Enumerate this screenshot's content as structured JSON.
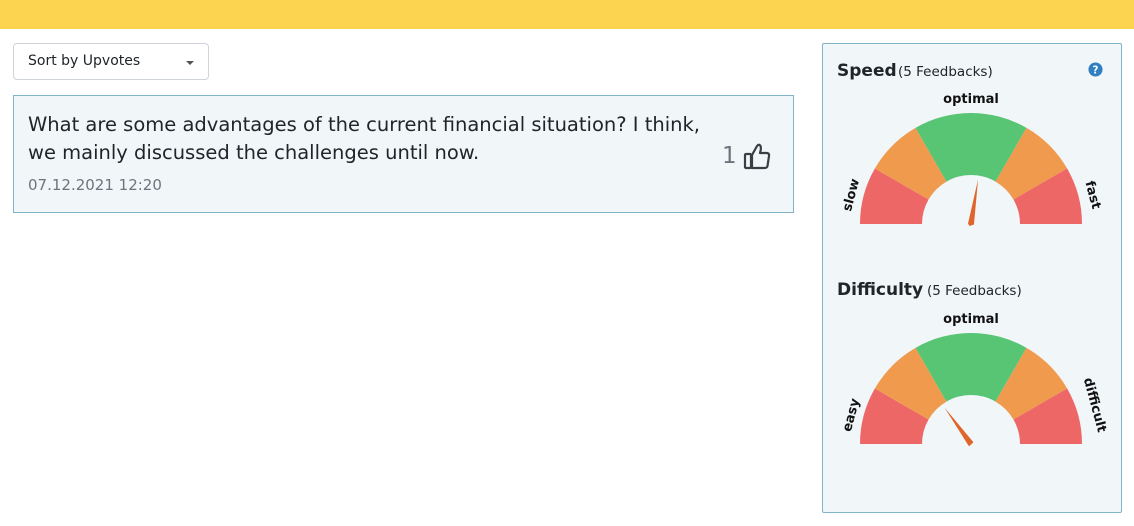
{
  "header": {
    "color": "#fdd44f"
  },
  "sort": {
    "selected": "Sort by Upvotes"
  },
  "question": {
    "text": "What are some advantages of the current financial situation? I think, we mainly discussed the challenges until now.",
    "timestamp": "07.12.2021 12:20",
    "upvotes": "1",
    "upvote_icon": "thumbs-up-icon"
  },
  "feedback": {
    "help_icon": "question-circle-icon",
    "speed": {
      "title": "Speed",
      "count": "(5 Feedbacks)",
      "label_top": "optimal",
      "label_left": "slow",
      "label_right": "fast",
      "needle_level": 0.55
    },
    "difficulty": {
      "title": "Difficulty",
      "count": "(5 Feedbacks)",
      "label_top": "optimal",
      "label_left": "easy",
      "label_right": "difficult",
      "needle_level": 0.3
    },
    "colors": {
      "red": "#ee6767",
      "orange": "#f09a4e",
      "green": "#57c574",
      "needle": "#e0652a"
    }
  }
}
